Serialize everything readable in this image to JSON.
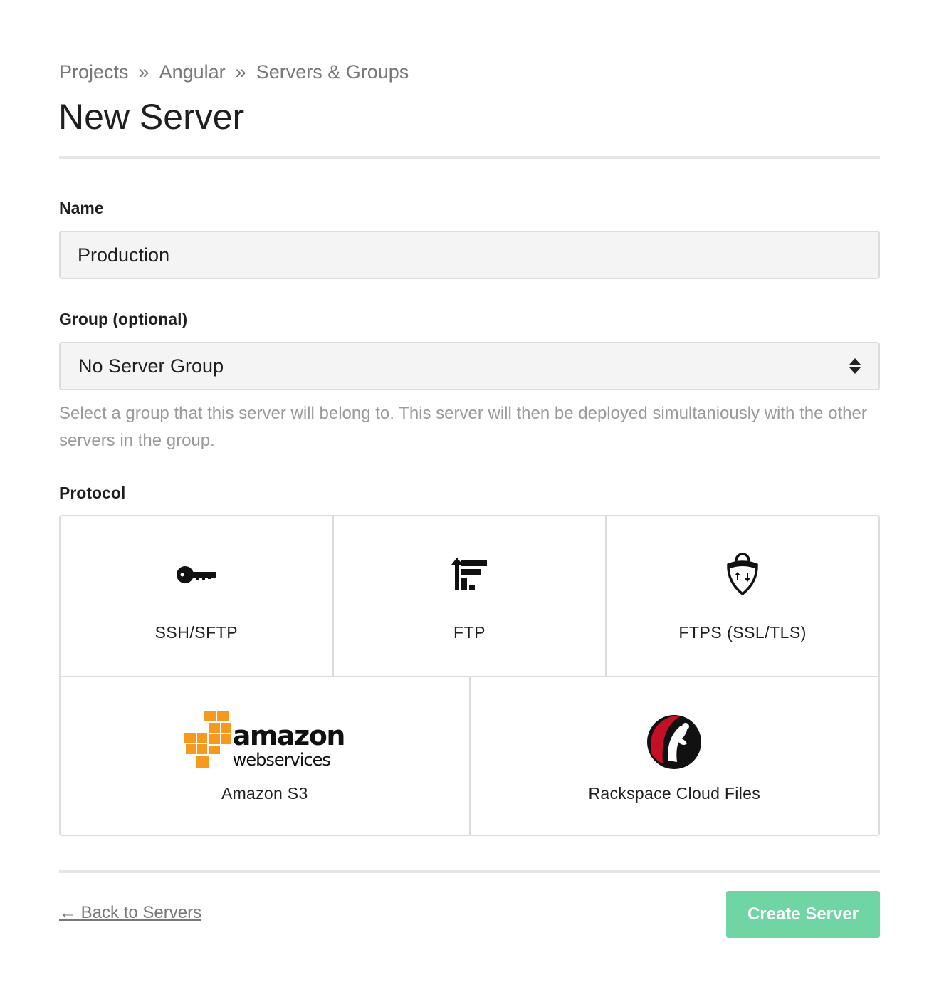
{
  "breadcrumb": {
    "items": [
      "Projects",
      "Angular",
      "Servers & Groups"
    ],
    "separator": "»"
  },
  "page": {
    "title": "New Server"
  },
  "form": {
    "name": {
      "label": "Name",
      "value": "Production"
    },
    "group": {
      "label": "Group (optional)",
      "selected": "No Server Group",
      "help": "Select a group that this server will belong to. This server will then be deployed simultaniously with the other servers in the group."
    },
    "protocol": {
      "label": "Protocol",
      "options": [
        {
          "label": "SSH/SFTP",
          "icon": "key-icon"
        },
        {
          "label": "FTP",
          "icon": "ftp-icon"
        },
        {
          "label": "FTPS (SSL/TLS)",
          "icon": "shield-lock-icon"
        },
        {
          "label": "Amazon S3",
          "icon": "aws-logo",
          "logo_text": [
            "amazon",
            "webservices"
          ]
        },
        {
          "label": "Rackspace Cloud Files",
          "icon": "rackspace-logo"
        }
      ]
    }
  },
  "footer": {
    "back_label": "← Back to Servers",
    "submit_label": "Create Server"
  },
  "colors": {
    "accent": "#6fd5a4",
    "aws_orange": "#f7981f",
    "rackspace_red": "#c40f24"
  }
}
